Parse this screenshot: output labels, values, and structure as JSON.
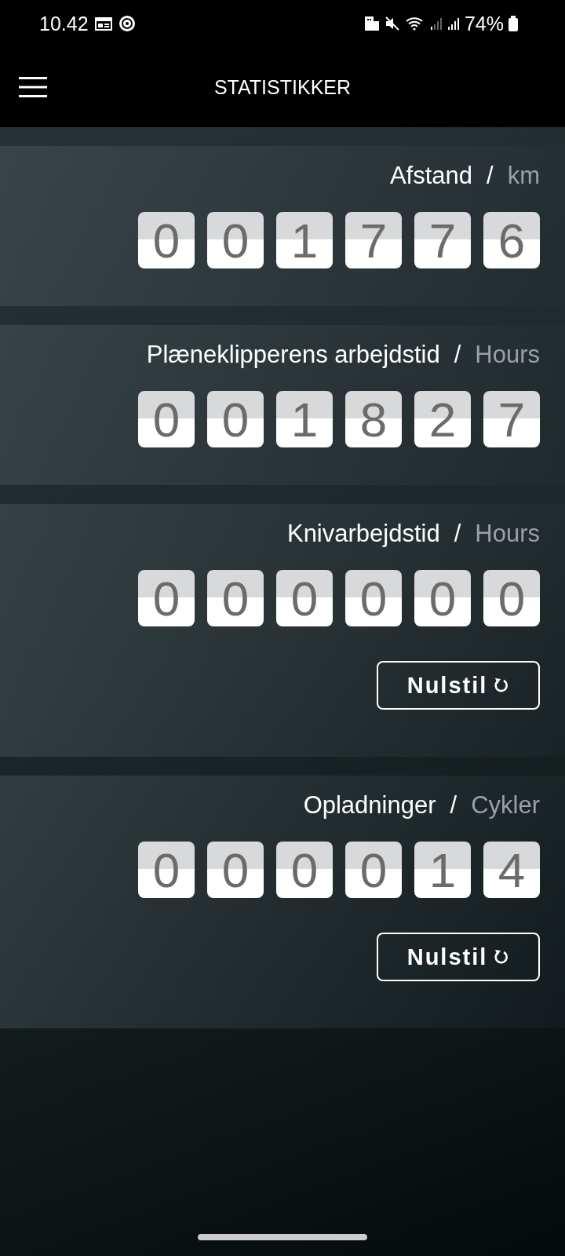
{
  "status_bar": {
    "time": "10.42",
    "battery": "74%"
  },
  "header": {
    "title": "STATISTIKKER"
  },
  "counters": [
    {
      "label": "Afstand",
      "separator": "/",
      "unit": "km",
      "digits": [
        "0",
        "0",
        "1",
        "7",
        "7",
        "6"
      ]
    },
    {
      "label": "Plæneklipperens arbejdstid",
      "separator": "/",
      "unit": "Hours",
      "digits": [
        "0",
        "0",
        "1",
        "8",
        "2",
        "7"
      ]
    },
    {
      "label": "Knivarbejdstid",
      "separator": "/",
      "unit": "Hours",
      "digits": [
        "0",
        "0",
        "0",
        "0",
        "0",
        "0"
      ],
      "reset_button": "Nulstil"
    },
    {
      "label": "Opladninger",
      "separator": "/",
      "unit": "Cykler",
      "digits": [
        "0",
        "0",
        "0",
        "0",
        "1",
        "4"
      ],
      "reset_button": "Nulstil"
    }
  ]
}
